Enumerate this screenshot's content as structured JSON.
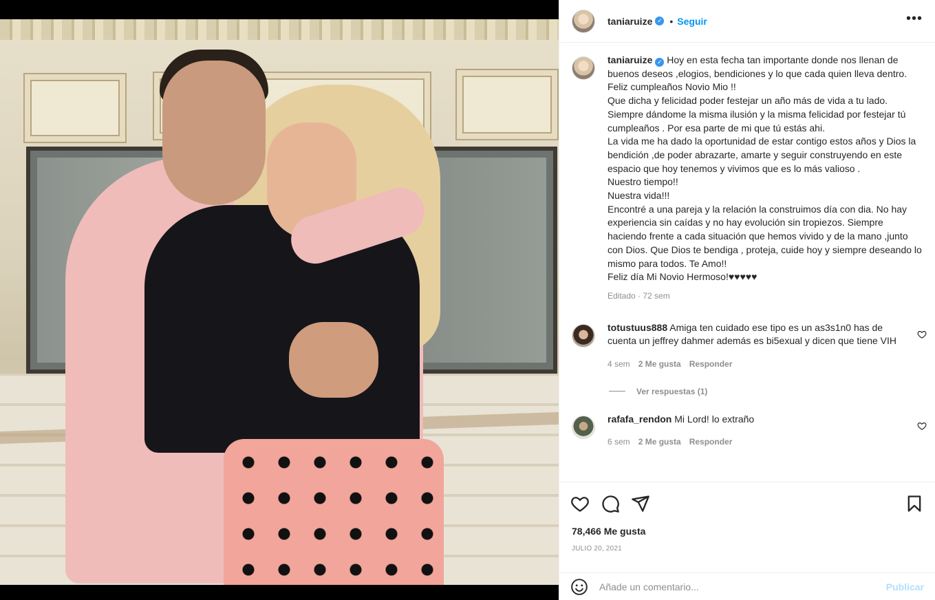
{
  "post": {
    "author": "taniaruize",
    "verified": true,
    "follow_label": "Seguir",
    "more_label": "•••",
    "caption": "Hoy en esta fecha tan importante donde nos llenan de buenos deseos ,elogios, bendiciones y lo que cada quien lleva dentro.\nFeliz cumpleaños Novio Mio !!\nQue dicha y felicidad poder festejar un año más de vida a tu lado. Siempre dándome la misma ilusión y la misma felicidad por festejar tú cumpleaños . Por esa parte de mi que tú estás ahi.\nLa vida me ha dado la oportunidad de estar contigo estos años y Dios la bendición ,de poder abrazarte, amarte y seguir construyendo en este espacio que hoy tenemos y vivimos que es lo más valioso .\nNuestro tiempo!!\nNuestra vida!!!\nEncontré a una pareja y la relación la construimos día con dia. No hay experiencia sin caídas y no hay evolución sin tropiezos. Siempre haciendo frente a cada situación que hemos vivido y de la mano ,junto con Dios. Que Dios te bendiga , proteja, cuide hoy y siempre deseando lo mismo para todos. Te Amo!!\nFeliz día Mi Novio Hermoso!♥♥♥♥♥",
    "caption_meta": "Editado · 72 sem",
    "likes": "78,466 Me gusta",
    "date": "JULIO 20, 2021"
  },
  "comments": [
    {
      "user": "totustuus888",
      "text": "Amiga ten cuidado ese tipo es un as3s1n0 has de cuenta un jeffrey dahmer además es bi5exual y dicen que tiene VIH",
      "time": "4 sem",
      "likes": "2 Me gusta",
      "reply": "Responder",
      "view_replies": "Ver respuestas (1)"
    },
    {
      "user": "rafafa_rendon",
      "text": "Mi Lord! lo extraño",
      "time": "6 sem",
      "likes": "2 Me gusta",
      "reply": "Responder"
    }
  ],
  "composer": {
    "placeholder": "Añade un comentario...",
    "publish_label": "Publicar"
  },
  "icons": {
    "like": "heart-icon",
    "comment": "comment-bubble-icon",
    "share": "paper-plane-icon",
    "save": "bookmark-icon",
    "emoji": "smiley-icon",
    "verified": "verified-badge-icon",
    "more": "more-dots-icon"
  },
  "colors": {
    "accent": "#0095f6",
    "verified": "#3897f0",
    "publish_disabled": "#b2dffc",
    "muted_text": "#8e8e8e"
  }
}
